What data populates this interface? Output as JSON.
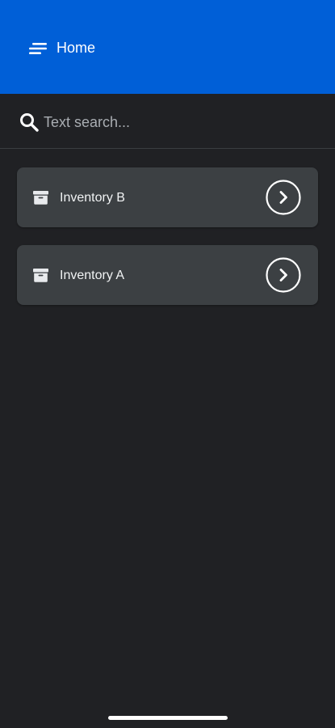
{
  "header": {
    "title": "Home",
    "menu_icon": "menu-lines-icon",
    "background_color": "#005fd7"
  },
  "search": {
    "placeholder": "Text search...",
    "value": "",
    "icon": "search-icon"
  },
  "inventories": [
    {
      "label": "Inventory B",
      "icon": "archive-box-icon",
      "action_icon": "chevron-right-circle-icon"
    },
    {
      "label": "Inventory A",
      "icon": "archive-box-icon",
      "action_icon": "chevron-right-circle-icon"
    }
  ],
  "theme": {
    "background": "#202124",
    "card": "#3c4043",
    "text": "#f1f3f4"
  }
}
